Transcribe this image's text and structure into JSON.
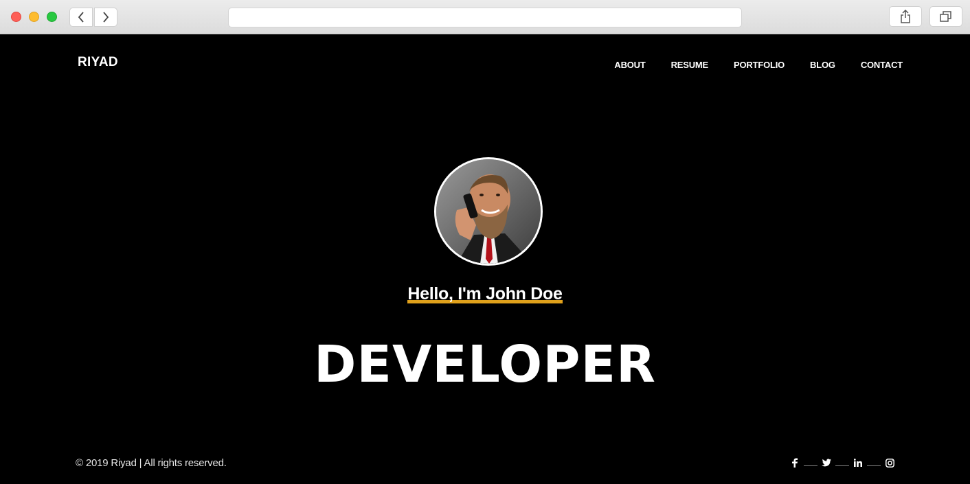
{
  "browser": {
    "url": ""
  },
  "site": {
    "logo": "RIYAD",
    "nav": [
      "ABOUT",
      "RESUME",
      "PORTFOLIO",
      "BLOG",
      "CONTACT"
    ]
  },
  "hero": {
    "greeting": "Hello, I'm John Doe",
    "role": "DEVELOPER",
    "avatar_icon": "profile-photo",
    "accent_color": "#e0a11b"
  },
  "footer": {
    "copyright": "© 2019 Riyad | All rights reserved.",
    "social": [
      "facebook-icon",
      "twitter-icon",
      "linkedin-icon",
      "instagram-icon"
    ]
  }
}
